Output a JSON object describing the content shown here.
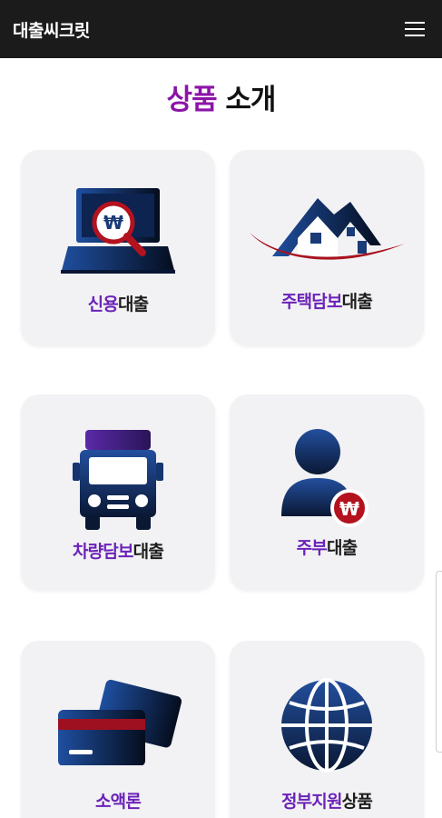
{
  "header": {
    "app_title": "대출씨크릿"
  },
  "section": {
    "title_accent": "상품",
    "title_rest": "소개"
  },
  "products": [
    {
      "highlight": "신용",
      "suffix": "대출",
      "icon": "laptop-won-magnifier-icon"
    },
    {
      "highlight": "주택담보",
      "suffix": "대출",
      "icon": "house-roof-icon"
    },
    {
      "highlight": "차량담보",
      "suffix": "대출",
      "icon": "truck-icon"
    },
    {
      "highlight": "주부",
      "suffix": "대출",
      "icon": "person-won-icon"
    },
    {
      "highlight": "소액론",
      "suffix": "",
      "icon": "credit-card-icon"
    },
    {
      "highlight": "정부지원",
      "suffix": "상품",
      "icon": "globe-icon"
    }
  ],
  "colors": {
    "accent_purple": "#8b14a8",
    "label_purple": "#6b22b8",
    "icon_navy": "#1a3a78",
    "icon_red": "#b3121e",
    "header_bg": "#1b1b1b",
    "card_bg": "#f2f2f4"
  }
}
